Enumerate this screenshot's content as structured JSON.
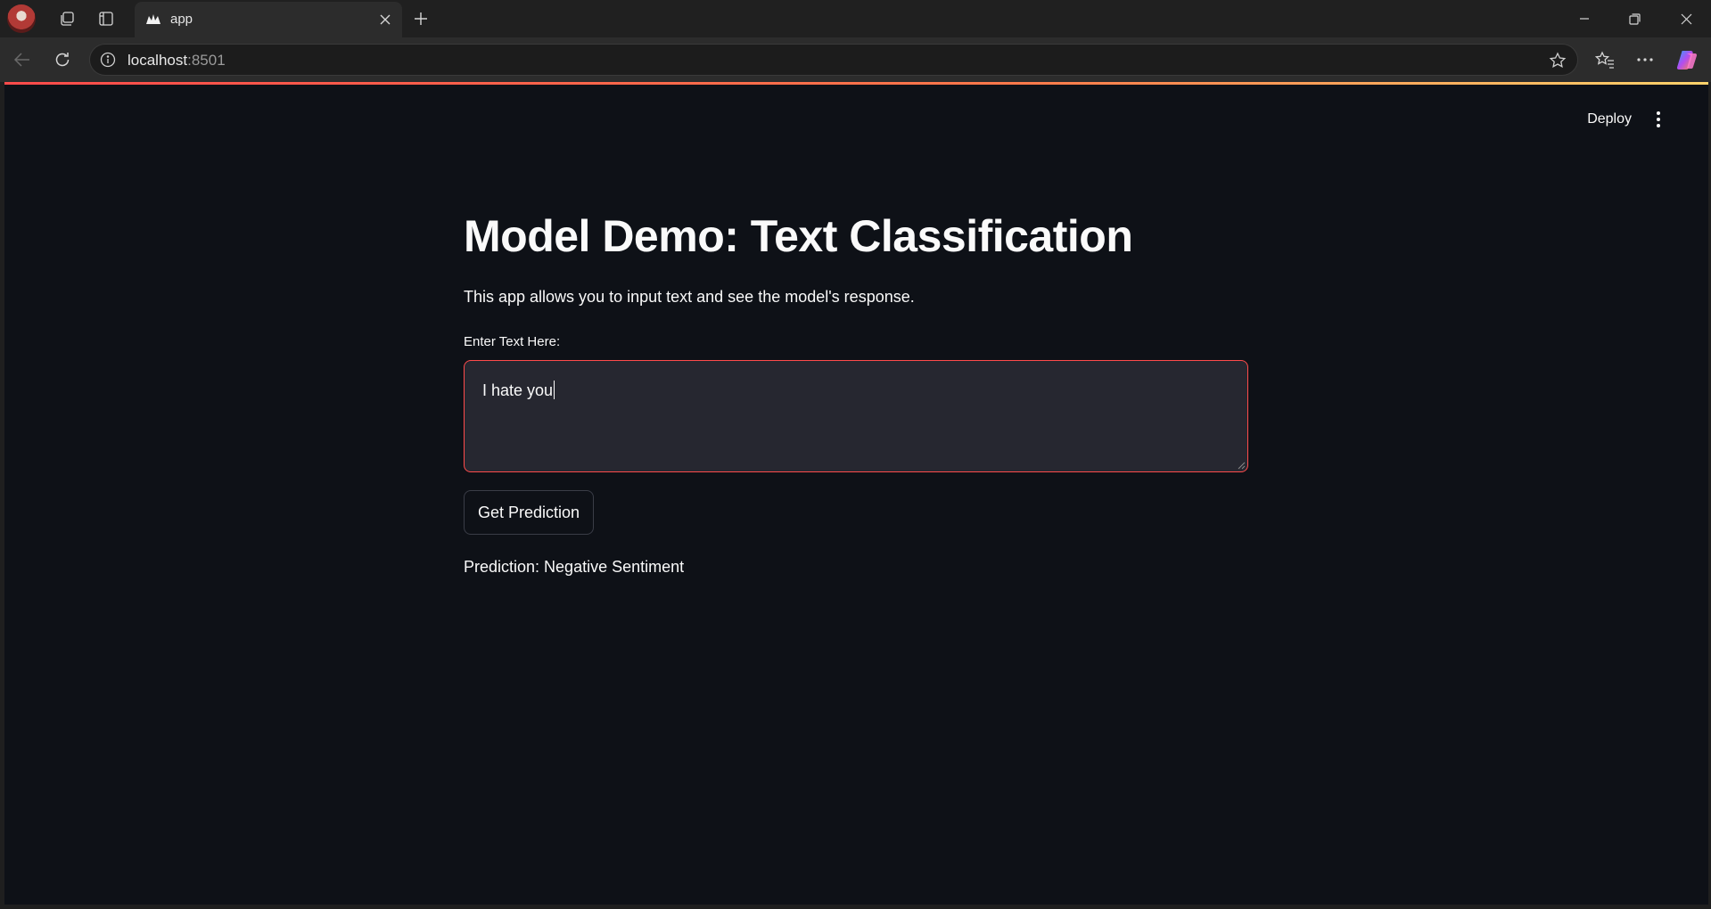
{
  "browser": {
    "tab_title": "app",
    "url_host": "localhost",
    "url_port": ":8501"
  },
  "app": {
    "deploy_label": "Deploy",
    "title": "Model Demo: Text Classification",
    "description": "This app allows you to input text and see the model's response.",
    "input_label": "Enter Text Here:",
    "input_value": "I hate you",
    "button_label": "Get Prediction",
    "prediction_text": "Prediction: Negative Sentiment"
  },
  "colors": {
    "primary": "#ff4b4b",
    "background": "#0e1117",
    "input_background": "#262730"
  },
  "icons": [
    "profile-avatar",
    "workspaces-icon",
    "tab-actions-icon",
    "streamlit-favicon",
    "close-icon",
    "plus-icon",
    "minimize-icon",
    "restore-icon",
    "window-close-icon",
    "back-icon",
    "refresh-icon",
    "info-icon",
    "star-icon",
    "favorites-icon",
    "more-icon",
    "copilot-icon",
    "kebab-menu-icon"
  ]
}
